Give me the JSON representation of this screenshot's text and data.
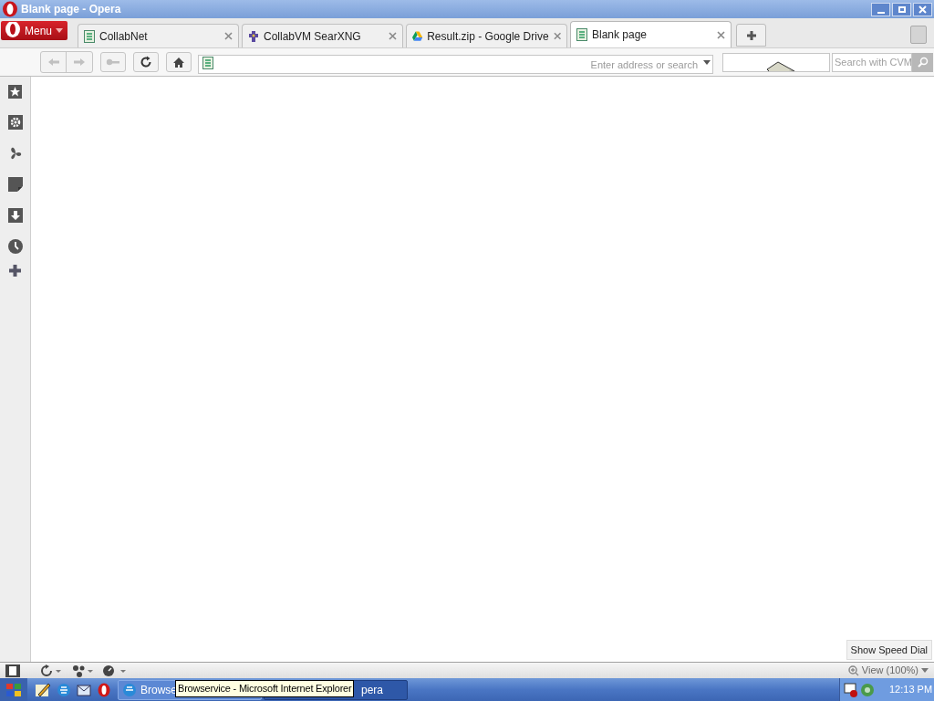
{
  "window": {
    "title": "Blank page - Opera"
  },
  "menu_button": {
    "label": "Menu"
  },
  "tabs": [
    {
      "label": "CollabNet",
      "selected": false,
      "kind": "page"
    },
    {
      "label": "CollabVM SearXNG",
      "selected": false,
      "kind": "puzzle"
    },
    {
      "label": "Result.zip - Google Drive",
      "selected": false,
      "kind": "drive"
    },
    {
      "label": "Blank page",
      "selected": true,
      "kind": "page"
    }
  ],
  "address_bar": {
    "placeholder": "Enter address or search"
  },
  "search_field": {
    "placeholder": "Search with CVM"
  },
  "speed_dial_tooltip": "Show Speed Dial",
  "status_bar": {
    "zoom": "View (100%)"
  },
  "taskbar": {
    "tasks": [
      {
        "label": "Browse",
        "selected": false
      },
      {
        "label": "pera",
        "selected": true
      }
    ],
    "tooltip": "Browservice - Microsoft Internet Explorer",
    "clock": "12:13 PM"
  }
}
